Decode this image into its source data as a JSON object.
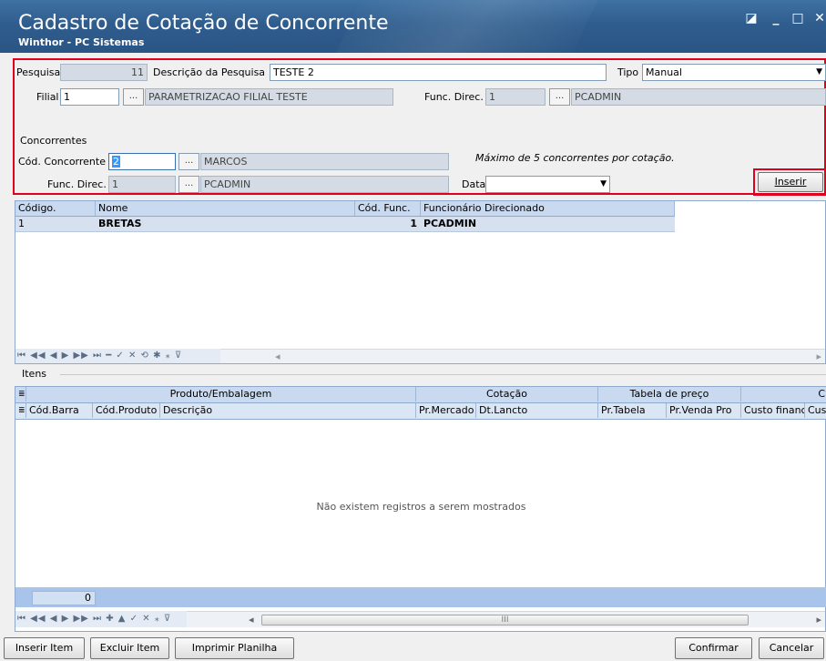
{
  "window": {
    "title": "Cadastro de Cotação de Concorrente",
    "subtitle": "Winthor - PC Sistemas",
    "controls": [
      "◪",
      "_",
      "□",
      "✕"
    ]
  },
  "header": {
    "pesquisa_label": "Pesquisa",
    "pesquisa_value": "11",
    "descricao_label": "Descrição da Pesquisa",
    "descricao_value": "TESTE 2",
    "tipo_label": "Tipo",
    "tipo_value": "Manual",
    "filial_label": "Filial",
    "filial_value": "1",
    "filial_desc": "PARAMETRIZACAO FILIAL TESTE",
    "funcdirec_label": "Func. Direc.",
    "funcdirec_value": "1",
    "funcdirec_desc": "PCADMIN",
    "concorrentes_label": "Concorrentes",
    "codconc_label": "Cód. Concorrente",
    "codconc_value": "2",
    "codconc_desc": "MARCOS",
    "max_note": "Máximo de 5 concorrentes por cotação.",
    "funcdirec2_label": "Func. Direc.",
    "funcdirec2_value": "1",
    "funcdirec2_desc": "PCADMIN",
    "data_label": "Data",
    "data_value": "",
    "dots": "...",
    "inserir": "Inserir"
  },
  "competitors": {
    "columns": [
      "Código.",
      "Nome",
      "Cód. Func.",
      "Funcionário Direcionado"
    ],
    "rows": [
      [
        "1",
        "BRETAS",
        "1",
        "PCADMIN"
      ]
    ],
    "nav": "⏮ ◀◀ ◀ ▶ ▶▶ ⏭ ━ ✓ ✕ ⟲ ✱ ⁎ ⊽"
  },
  "itens": {
    "label": "Itens",
    "group_cols": [
      "Produto/Embalagem",
      "Cotação",
      "Tabela de preço",
      "C"
    ],
    "columns": [
      "Cód.Barra",
      "Cód.Produto",
      "Descrição",
      "Pr.Mercado",
      "Dt.Lancto",
      "Pr.Tabela",
      "Pr.Venda Pro",
      "Custo financ",
      "Cus"
    ],
    "empty_msg": "Não existem registros a serem mostrados",
    "total": "0",
    "nav": "⏮ ◀◀ ◀ ▶ ▶▶ ⏭ ✚ ▲ ✓ ✕ ⁎ ⊽",
    "hscroll_mark": "III"
  },
  "buttons": {
    "inserir_item": "Inserir Item",
    "excluir_item": "Excluir Item",
    "imprimir": "Imprimir Planilha",
    "confirmar": "Confirmar",
    "cancelar": "Cancelar"
  }
}
